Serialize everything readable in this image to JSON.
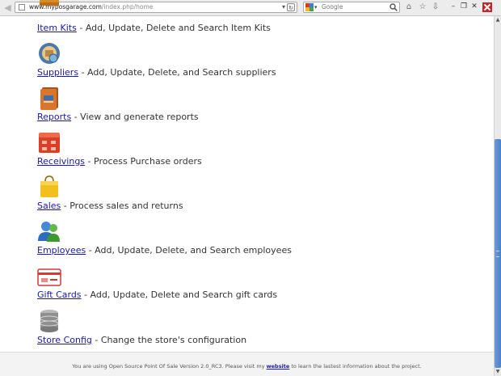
{
  "browser": {
    "url_host": "www.myposgarage.com",
    "url_path": "/index.php/home",
    "search_placeholder": "Google",
    "accent_scroll": "#5a8ccf"
  },
  "modules": [
    {
      "name": "Item Kits",
      "description": " - Add, Update, Delete and Search Item Kits",
      "icon": "item-kits-icon"
    },
    {
      "name": "Suppliers",
      "description": " - Add, Update, Delete, and Search suppliers",
      "icon": "suppliers-icon"
    },
    {
      "name": "Reports",
      "description": " - View and generate reports",
      "icon": "reports-icon"
    },
    {
      "name": "Receivings",
      "description": " - Process Purchase orders",
      "icon": "receivings-icon"
    },
    {
      "name": "Sales",
      "description": " - Process sales and returns",
      "icon": "sales-icon"
    },
    {
      "name": "Employees",
      "description": " - Add, Update, Delete, and Search employees",
      "icon": "employees-icon"
    },
    {
      "name": "Gift Cards",
      "description": " - Add, Update, Delete and Search gift cards",
      "icon": "gift-cards-icon"
    },
    {
      "name": "Store Config",
      "description": " - Change the store's configuration",
      "icon": "store-config-icon"
    }
  ],
  "footer": {
    "text_before": "You are using Open Source Point Of Sale Version 2.0_RC3. Please visit my ",
    "link": "website",
    "text_after": " to learn the lastest information about the project."
  }
}
